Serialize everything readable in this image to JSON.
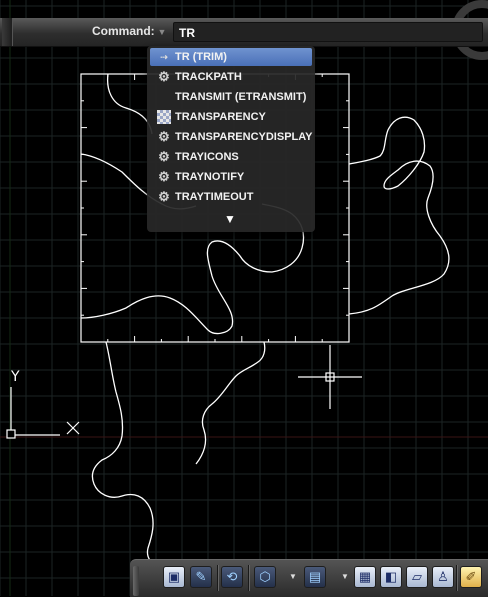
{
  "command_bar": {
    "label": "Command:",
    "dropdown_icon": "triangle-down-icon",
    "input_value": "TR"
  },
  "autocomplete": {
    "items": [
      {
        "label": "TR (TRIM)",
        "icon": "command-icon",
        "selected": true
      },
      {
        "label": "TRACKPATH",
        "icon": "gear-icon"
      },
      {
        "label": "TRANSMIT (ETRANSMIT)",
        "icon": ""
      },
      {
        "label": "TRANSPARENCY",
        "icon": "transparency-icon"
      },
      {
        "label": "TRANSPARENCYDISPLAY",
        "icon": "gear-icon"
      },
      {
        "label": "TRAYICONS",
        "icon": "gear-icon"
      },
      {
        "label": "TRAYNOTIFY",
        "icon": "gear-icon"
      },
      {
        "label": "TRAYTIMEOUT",
        "icon": "gear-icon"
      }
    ],
    "more_glyph": "▼"
  },
  "ucs_icon": {
    "y_label": "Y",
    "x_label": "X"
  },
  "toolbar": {
    "buttons": [
      "insert-block-icon",
      "draw-icon",
      "orbit-icon",
      "visual-style-icon",
      "view-cube-icon",
      "grid-snap-icon",
      "layer-icon",
      "annotate-icon",
      "person-icon",
      "pen-icon"
    ]
  },
  "colors": {
    "background": "#000000",
    "grid": "#15201f",
    "drawing": "#ffffff",
    "selected_item": "#5a7fc2",
    "x_axis": "#3a1212"
  }
}
